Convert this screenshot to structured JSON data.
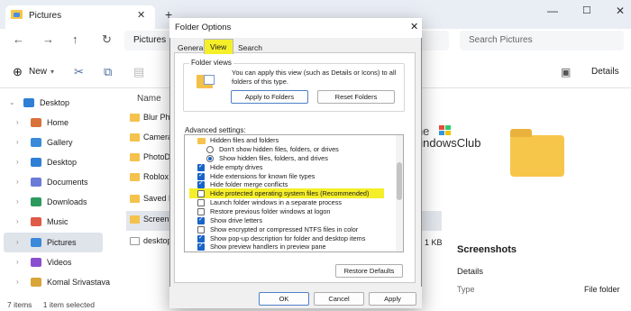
{
  "explorer": {
    "tab_title": "Pictures",
    "address": "Pictures",
    "search_placeholder": "Search Pictures",
    "new_label": "New",
    "details_label": "Details",
    "sidebar": [
      {
        "label": "Desktop",
        "color": "#2f7fd6"
      },
      {
        "label": "Home",
        "color": "#d9713a"
      },
      {
        "label": "Gallery",
        "color": "#3a8ad9"
      },
      {
        "label": "Desktop",
        "color": "#2f7fd6"
      },
      {
        "label": "Documents",
        "color": "#6a7bd8"
      },
      {
        "label": "Downloads",
        "color": "#2b9a5d"
      },
      {
        "label": "Music",
        "color": "#e05a4a"
      },
      {
        "label": "Pictures",
        "color": "#3a8ad9"
      },
      {
        "label": "Videos",
        "color": "#8a4fcf"
      },
      {
        "label": "Komal Srivastava",
        "color": "#d9a43a"
      }
    ],
    "name_header": "Name",
    "files": [
      "Blur Pho",
      "Camera",
      "PhotoD",
      "Roblox",
      "Saved P",
      "Screens",
      "desktop"
    ],
    "size": "1 KB",
    "status_left": "7 items",
    "status_mid": "1 item selected",
    "watermark_the": "The",
    "watermark_club": "WindowsClub",
    "detail_title": "Screenshots",
    "detail_heading": "Details",
    "detail_type_label": "Type",
    "detail_type_value": "File folder"
  },
  "dialog": {
    "title": "Folder Options",
    "tabs": [
      "General",
      "View",
      "Search"
    ],
    "active_tab": "View",
    "folder_views_label": "Folder views",
    "folder_views_desc": "You can apply this view (such as Details or Icons) to all folders of this type.",
    "apply_to_folders": "Apply to Folders",
    "reset_folders": "Reset Folders",
    "advanced_label": "Advanced settings:",
    "options": [
      {
        "text": "Hidden files and folders",
        "kind": "folder"
      },
      {
        "text": "Don't show hidden files, folders, or drives",
        "kind": "radio",
        "checked": false
      },
      {
        "text": "Show hidden files, folders, and drives",
        "kind": "radio",
        "checked": true
      },
      {
        "text": "Hide empty drives",
        "kind": "check",
        "checked": true
      },
      {
        "text": "Hide extensions for known file types",
        "kind": "check",
        "checked": true
      },
      {
        "text": "Hide folder merge conflicts",
        "kind": "check",
        "checked": true
      },
      {
        "text": "Hide protected operating system files (Recommended)",
        "kind": "check",
        "checked": false
      },
      {
        "text": "Launch folder windows in a separate process",
        "kind": "check",
        "checked": false
      },
      {
        "text": "Restore previous folder windows at logon",
        "kind": "check",
        "checked": false
      },
      {
        "text": "Show drive letters",
        "kind": "check",
        "checked": true
      },
      {
        "text": "Show encrypted or compressed NTFS files in color",
        "kind": "check",
        "checked": false
      },
      {
        "text": "Show pop-up description for folder and desktop items",
        "kind": "check",
        "checked": true
      },
      {
        "text": "Show preview handlers in preview pane",
        "kind": "check",
        "checked": true
      }
    ],
    "highlight_color": "#f5ef2a",
    "restore_defaults": "Restore Defaults",
    "ok": "OK",
    "cancel": "Cancel",
    "apply": "Apply"
  }
}
